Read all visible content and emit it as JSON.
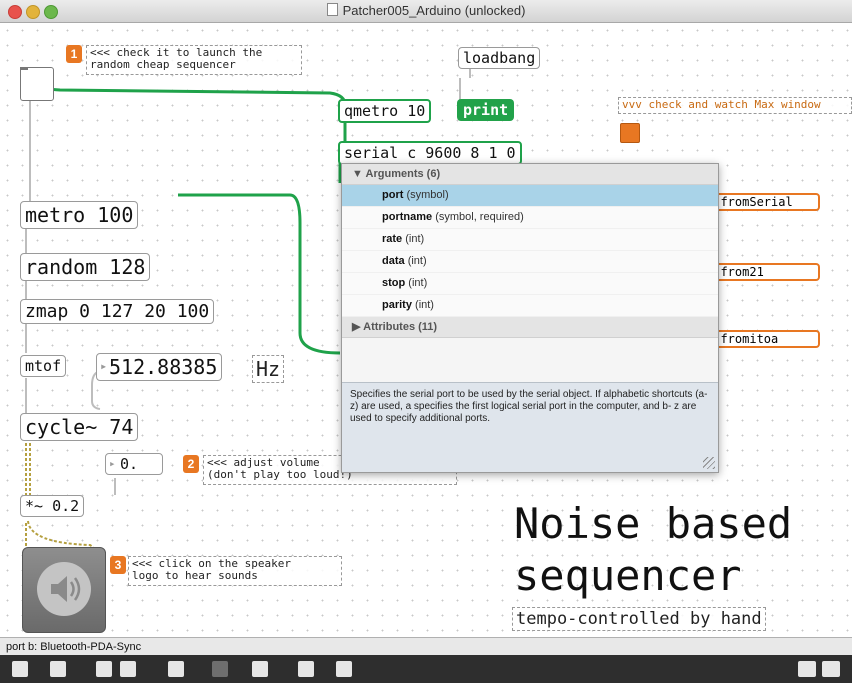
{
  "window": {
    "title": "Patcher005_Arduino (unlocked)"
  },
  "objects": {
    "loadbang": "loadbang",
    "qmetro": "qmetro 10",
    "print": "print",
    "serial": "serial c 9600 8 1 0",
    "metro": "metro 100",
    "random": "random 128",
    "zmap": "zmap 0 127 20 100",
    "mtof": "mtof",
    "freq_value": "512.88385",
    "hz": "Hz",
    "cycle": "cycle~ 74",
    "volume_value": "0.",
    "mult": "*~ 0.2",
    "from_serial": "t fromSerial",
    "from_21": "t from21",
    "from_itoa": "t fromitoa"
  },
  "comments": {
    "c1": "<<< check it to launch the\nrandom cheap sequencer",
    "c2": "<<< adjust volume\n(don't play too loud!)",
    "c3": "<<< click on the speaker\nlogo to hear sounds",
    "c4": "vvv check and watch Max window"
  },
  "badges": {
    "b1": "1",
    "b2": "2",
    "b3": "3"
  },
  "big_note": {
    "line1": "Noise based",
    "line2": "sequencer",
    "subtitle": "tempo-controlled by hand"
  },
  "popup": {
    "arguments_header": "Arguments (6)",
    "arguments": [
      {
        "name": "port",
        "type": "(symbol)"
      },
      {
        "name": "portname",
        "type": "(symbol, required)"
      },
      {
        "name": "rate",
        "type": "(int)"
      },
      {
        "name": "data",
        "type": "(int)"
      },
      {
        "name": "stop",
        "type": "(int)"
      },
      {
        "name": "parity",
        "type": "(int)"
      }
    ],
    "attributes_header": "Attributes (11)",
    "description": "Specifies the serial port to be used by the serial object. If alphabetic shortcuts (a-z) are used, a specifies the first logical serial port in the computer, and b- z are used to specify additional ports."
  },
  "statusbar": {
    "text": "port b: Bluetooth-PDA-Sync"
  },
  "colors": {
    "cable": "#1fa24a",
    "badge": "#e87722",
    "selection": "#a9d3e8"
  }
}
